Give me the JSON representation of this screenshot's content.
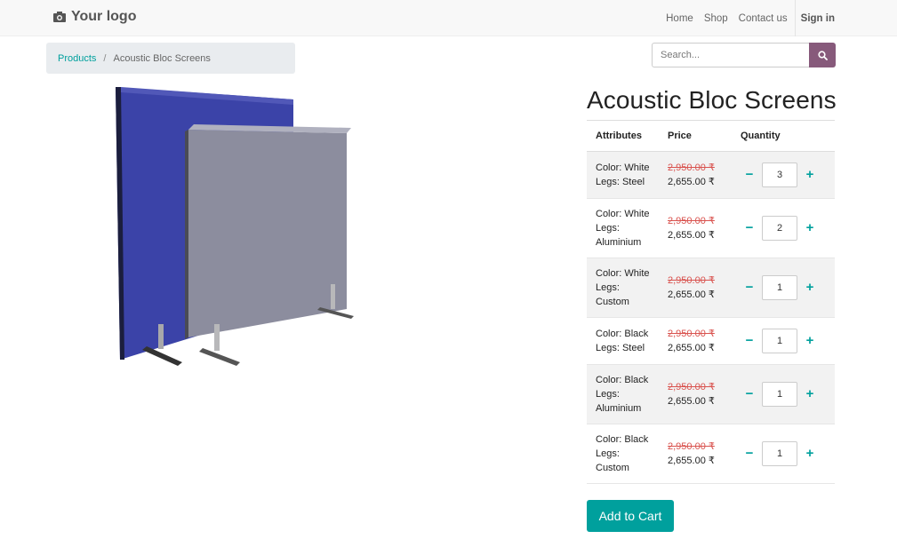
{
  "navbar": {
    "logo_text": "Your logo",
    "links": [
      "Home",
      "Shop",
      "Contact us"
    ],
    "signin": "Sign in"
  },
  "breadcrumb": {
    "parent": "Products",
    "separator": "/",
    "current": "Acoustic Bloc Screens"
  },
  "search": {
    "placeholder": "Search..."
  },
  "product": {
    "title": "Acoustic Bloc Screens",
    "image_icon": "acoustic-screens-image"
  },
  "table": {
    "headers": {
      "attributes": "Attributes",
      "price": "Price",
      "quantity": "Quantity"
    },
    "rows": [
      {
        "attr_lines": [
          "Color: White",
          "Legs: Steel"
        ],
        "old_price": "2,950.00 ₹",
        "price": "2,655.00 ₹",
        "qty": "3"
      },
      {
        "attr_lines": [
          "Color: White",
          "Legs:",
          "Aluminium"
        ],
        "old_price": "2,950.00 ₹",
        "price": "2,655.00 ₹",
        "qty": "2"
      },
      {
        "attr_lines": [
          "Color: White",
          "Legs:",
          "Custom"
        ],
        "old_price": "2,950.00 ₹",
        "price": "2,655.00 ₹",
        "qty": "1"
      },
      {
        "attr_lines": [
          "Color: Black",
          "Legs: Steel"
        ],
        "old_price": "2,950.00 ₹",
        "price": "2,655.00 ₹",
        "qty": "1"
      },
      {
        "attr_lines": [
          "Color: Black",
          "Legs:",
          "Aluminium"
        ],
        "old_price": "2,950.00 ₹",
        "price": "2,655.00 ₹",
        "qty": "1"
      },
      {
        "attr_lines": [
          "Color: Black",
          "Legs:",
          "Custom"
        ],
        "old_price": "2,950.00 ₹",
        "price": "2,655.00 ₹",
        "qty": "1"
      }
    ],
    "minus": "−",
    "plus": "+"
  },
  "cart": {
    "button_label": "Add to Cart"
  },
  "colors": {
    "accent": "#00a09d",
    "brand": "#875a7b",
    "old_price": "#d9534f"
  }
}
